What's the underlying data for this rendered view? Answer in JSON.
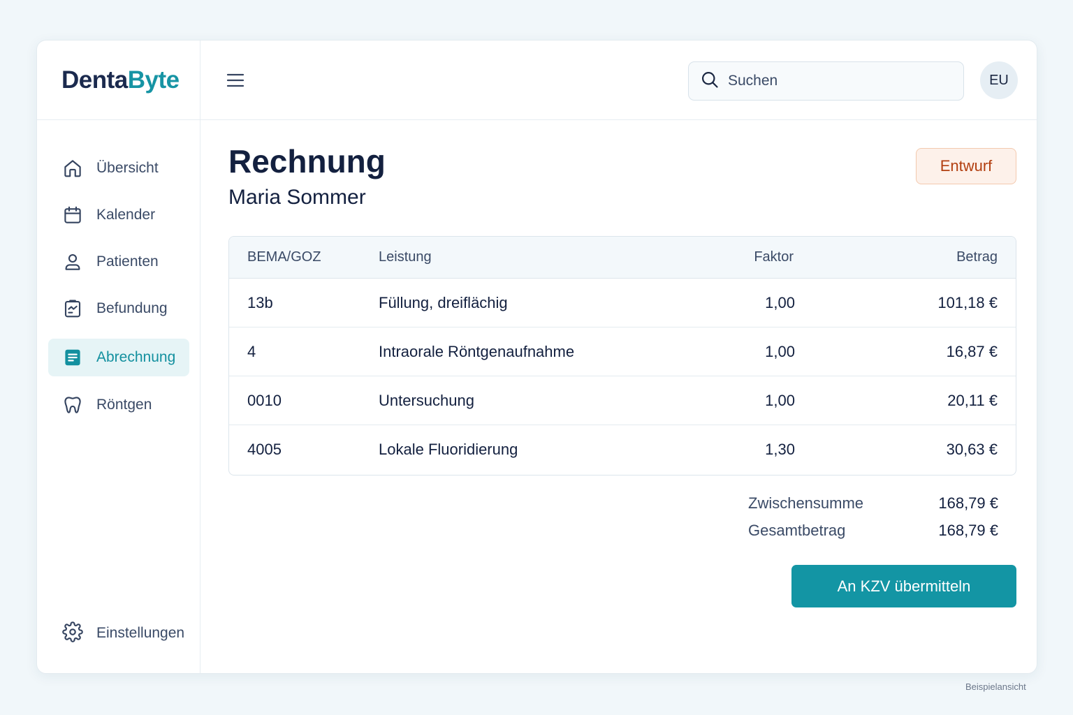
{
  "app": {
    "logo_part1": "Denta",
    "logo_part2": "Byte"
  },
  "sidebar": {
    "items": [
      {
        "label": "Übersicht",
        "icon": "home-icon"
      },
      {
        "label": "Kalender",
        "icon": "calendar-icon"
      },
      {
        "label": "Patienten",
        "icon": "user-icon"
      },
      {
        "label": "Befundung",
        "icon": "clipboard-chart-icon"
      },
      {
        "label": "Abrechnung",
        "icon": "invoice-icon",
        "active": true
      },
      {
        "label": "Röntgen",
        "icon": "tooth-icon"
      }
    ],
    "settings_label": "Einstellungen"
  },
  "topbar": {
    "search_placeholder": "Suchen",
    "avatar_initials": "EU"
  },
  "page": {
    "title": "Rechnung",
    "patient": "Maria Sommer",
    "status": "Entwurf"
  },
  "table": {
    "headers": {
      "code": "BEMA/GOZ",
      "service": "Leistung",
      "factor": "Faktor",
      "amount": "Betrag"
    },
    "rows": [
      {
        "code": "13b",
        "service": "Füllung, dreiflächig",
        "factor": "1,00",
        "amount": "101,18 €"
      },
      {
        "code": "4",
        "service": "Intraorale Röntgenaufnahme",
        "factor": "1,00",
        "amount": "16,87 €"
      },
      {
        "code": "0010",
        "service": "Untersuchung",
        "factor": "1,00",
        "amount": "20,11 €"
      },
      {
        "code": "4005",
        "service": "Lokale Fluoridierung",
        "factor": "1,30",
        "amount": "30,63 €"
      }
    ]
  },
  "totals": {
    "subtotal_label": "Zwischensumme",
    "subtotal_value": "168,79 €",
    "total_label": "Gesamtbetrag",
    "total_value": "168,79 €"
  },
  "actions": {
    "submit_label": "An KZV übermitteln"
  },
  "footer": {
    "caption": "Beispielansicht"
  },
  "colors": {
    "accent": "#1395a4",
    "brand_dark": "#1b2a4e",
    "draft_badge": "#b23f10"
  }
}
